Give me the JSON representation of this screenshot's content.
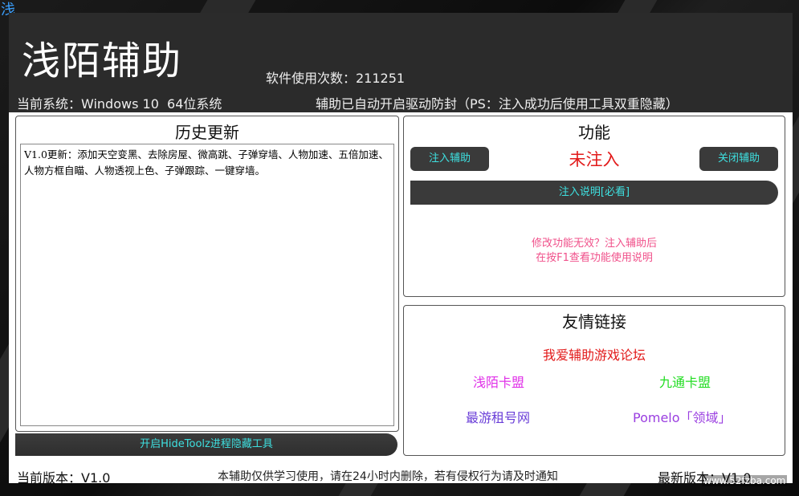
{
  "corner_char": "浅",
  "header": {
    "title": "浅陌辅助",
    "usage_label": "软件使用次数：211251",
    "system_info": "当前系统：Windows 10  64位系统",
    "protection_notice": "辅助已自动开启驱动防封（PS：注入成功后使用工具双重隐藏）"
  },
  "history": {
    "title": "历史更新",
    "content": "V1.0更新：添加天空变黑、去除房屋、微高跳、子弹穿墙、人物加速、五倍加速、人物方框自瞄、人物透视上色、子弹跟踪、一键穿墙。",
    "hide_tool_button": "开启HideToolz进程隐藏工具"
  },
  "functions": {
    "title": "功能",
    "inject_button": "注入辅助",
    "status": "未注入",
    "close_button": "关闭辅助",
    "guide_button": "注入说明[必看]",
    "tip_line1": "修改功能无效？注入辅助后",
    "tip_line2": "在按F1查看功能使用说明"
  },
  "links": {
    "title": "友情链接",
    "items": [
      {
        "label": "我爱辅助游戏论坛",
        "color": "#e21a1a"
      },
      {
        "label": "浅陌卡盟",
        "color": "#e030e8"
      },
      {
        "label": "九通卡盟",
        "color": "#22dd22"
      },
      {
        "label": "最游租号网",
        "color": "#6a3ed8"
      },
      {
        "label": "Pomelo「领域」",
        "color": "#9a3ee0"
      }
    ]
  },
  "footer": {
    "current_version": "当前版本：V1.0",
    "disclaimer": "本辅助仅供学习使用，请在24小时内删除，若有侵权行为请及时通知",
    "latest_version": "最新版本：V1.0"
  },
  "watermark": "www.52fzba.com"
}
